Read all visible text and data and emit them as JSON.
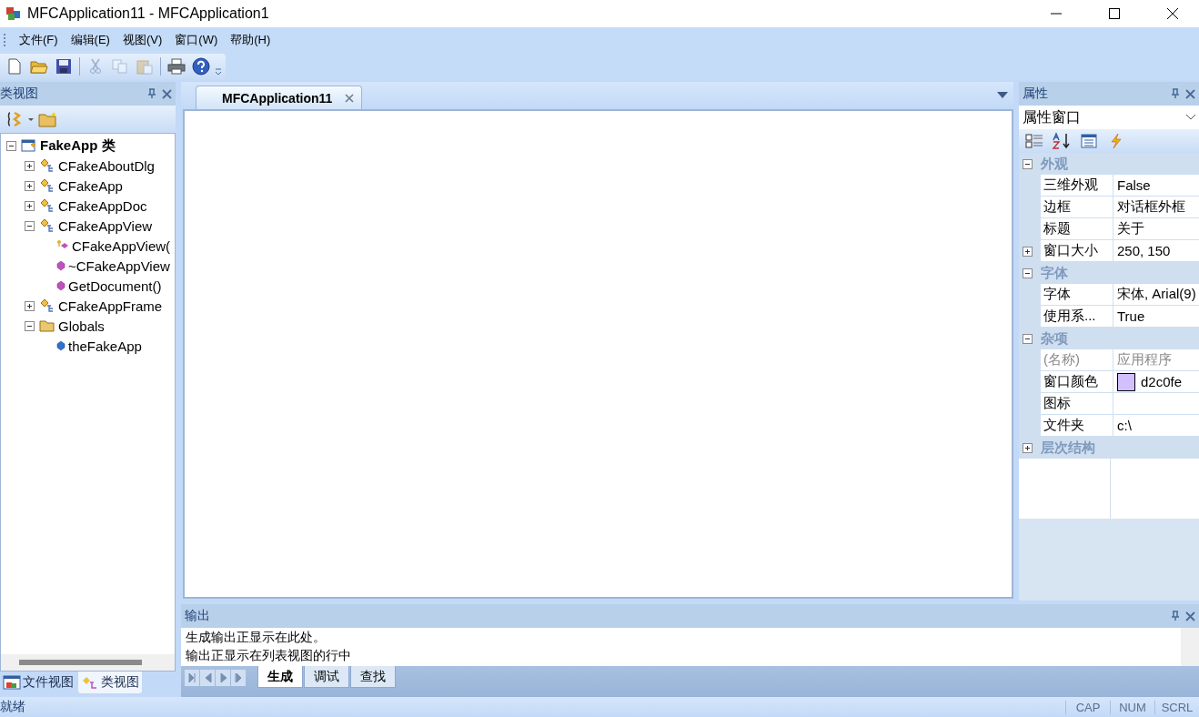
{
  "window": {
    "title": "MFCApplication11 - MFCApplication1"
  },
  "menu": [
    {
      "label": "文件(F)"
    },
    {
      "label": "编辑(E)"
    },
    {
      "label": "视图(V)"
    },
    {
      "label": "窗口(W)"
    },
    {
      "label": "帮助(H)"
    }
  ],
  "toolbar": [
    {
      "kind": "new",
      "disabled": false
    },
    {
      "kind": "open",
      "disabled": false
    },
    {
      "kind": "save",
      "disabled": false
    },
    {
      "kind": "separator"
    },
    {
      "kind": "cut",
      "disabled": true
    },
    {
      "kind": "copy",
      "disabled": true
    },
    {
      "kind": "paste",
      "disabled": true
    },
    {
      "kind": "separator"
    },
    {
      "kind": "print",
      "disabled": false
    },
    {
      "kind": "help",
      "disabled": false
    }
  ],
  "class_view": {
    "title": "类视图",
    "tree": [
      {
        "label": "FakeApp 类",
        "kind": "project",
        "expanded": true,
        "children": [
          {
            "label": "CFakeAboutDlg",
            "kind": "class",
            "expanded": false
          },
          {
            "label": "CFakeApp",
            "kind": "class",
            "expanded": false
          },
          {
            "label": "CFakeAppDoc",
            "kind": "class",
            "expanded": false
          },
          {
            "label": "CFakeAppView",
            "kind": "class",
            "expanded": true,
            "children": [
              {
                "label": "CFakeAppView(",
                "kind": "protected-method"
              },
              {
                "label": "~CFakeAppView",
                "kind": "method"
              },
              {
                "label": "GetDocument()",
                "kind": "method"
              }
            ]
          },
          {
            "label": "CFakeAppFrame",
            "kind": "class",
            "expanded": false
          },
          {
            "label": "Globals",
            "kind": "folder",
            "expanded": true,
            "children": [
              {
                "label": "theFakeApp",
                "kind": "variable"
              }
            ]
          }
        ]
      }
    ],
    "tabs": [
      {
        "label": "文件视图",
        "selected": false
      },
      {
        "label": "类视图",
        "selected": true
      }
    ]
  },
  "document_tab": {
    "label": "MFCApplication11",
    "selected": true
  },
  "properties": {
    "title": "属性",
    "combo": "属性窗口",
    "tools": [
      {
        "kind": "categorized",
        "selected": false
      },
      {
        "kind": "alphabetical",
        "selected": false
      },
      {
        "kind": "pages",
        "selected": false
      },
      {
        "kind": "events",
        "selected": false
      }
    ],
    "groups": [
      {
        "name": "外观",
        "expanded": true,
        "rows": [
          {
            "name": "三维外观",
            "value": "False",
            "disabled": false,
            "expandable": false
          },
          {
            "name": "边框",
            "value": "对话框外框",
            "disabled": false,
            "expandable": false
          },
          {
            "name": "标题",
            "value": "关于",
            "disabled": false,
            "expandable": false
          },
          {
            "name": "窗口大小",
            "value": "250, 150",
            "disabled": false,
            "expandable": true
          }
        ]
      },
      {
        "name": "字体",
        "expanded": true,
        "rows": [
          {
            "name": "字体",
            "value": "宋体, Arial(9)",
            "disabled": false,
            "expandable": false
          },
          {
            "name": "使用系...",
            "value": "True",
            "disabled": false,
            "expandable": false
          }
        ]
      },
      {
        "name": "杂项",
        "expanded": true,
        "rows": [
          {
            "name": "(名称)",
            "value": "应用程序",
            "disabled": true,
            "expandable": false
          },
          {
            "name": "窗口颜色",
            "value": "d2c0fe",
            "color": "#d2c0fe",
            "disabled": false,
            "expandable": false
          },
          {
            "name": "图标",
            "disabled": false,
            "expandable": false
          },
          {
            "name": "文件夹",
            "value": "c:\\",
            "disabled": false,
            "expandable": false
          }
        ]
      },
      {
        "name": "层次结构",
        "expanded": false
      }
    ]
  },
  "output": {
    "title": "输出",
    "lines": [
      "生成输出正显示在此处。",
      "输出正显示在列表视图的行中"
    ],
    "tabs": [
      {
        "label": "生成",
        "selected": true
      },
      {
        "label": "调试",
        "selected": false
      },
      {
        "label": "查找",
        "selected": false
      }
    ]
  },
  "status_bar": {
    "text": "就绪",
    "indicators": [
      "CAP",
      "NUM",
      "SCRL"
    ]
  }
}
